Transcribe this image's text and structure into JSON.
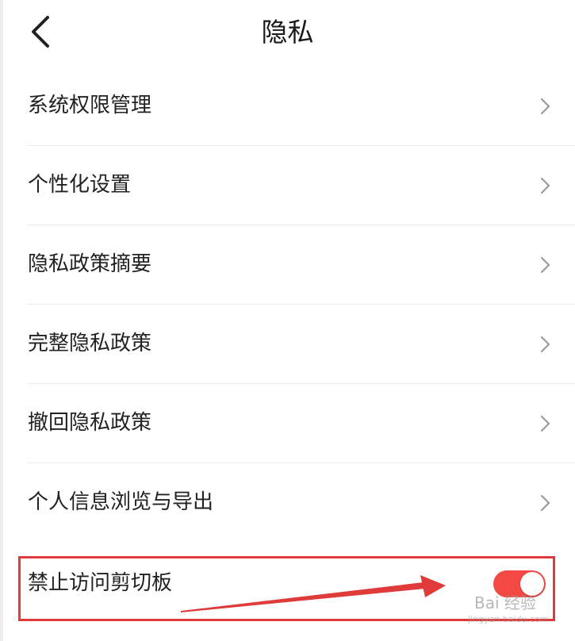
{
  "header": {
    "title": "隐私",
    "back_icon": "chevron-left-icon"
  },
  "menu": {
    "items": [
      {
        "label": "系统权限管理",
        "icon": "chevron-right-icon"
      },
      {
        "label": "个性化设置",
        "icon": "chevron-right-icon"
      },
      {
        "label": "隐私政策摘要",
        "icon": "chevron-right-icon"
      },
      {
        "label": "完整隐私政策",
        "icon": "chevron-right-icon"
      },
      {
        "label": "撤回隐私政策",
        "icon": "chevron-right-icon"
      },
      {
        "label": "个人信息浏览与导出",
        "icon": "chevron-right-icon"
      }
    ]
  },
  "toggle_row": {
    "label": "禁止访问剪切板",
    "enabled": true
  },
  "annotation": {
    "highlight_color": "#e03a3a",
    "arrow_color": "#e03a3a"
  },
  "watermark": {
    "brand": "Bai 经验",
    "url": "jingyan.baidu.com"
  },
  "colors": {
    "toggle_on": "#f24a42",
    "divider": "#ececec",
    "text": "#222222"
  }
}
